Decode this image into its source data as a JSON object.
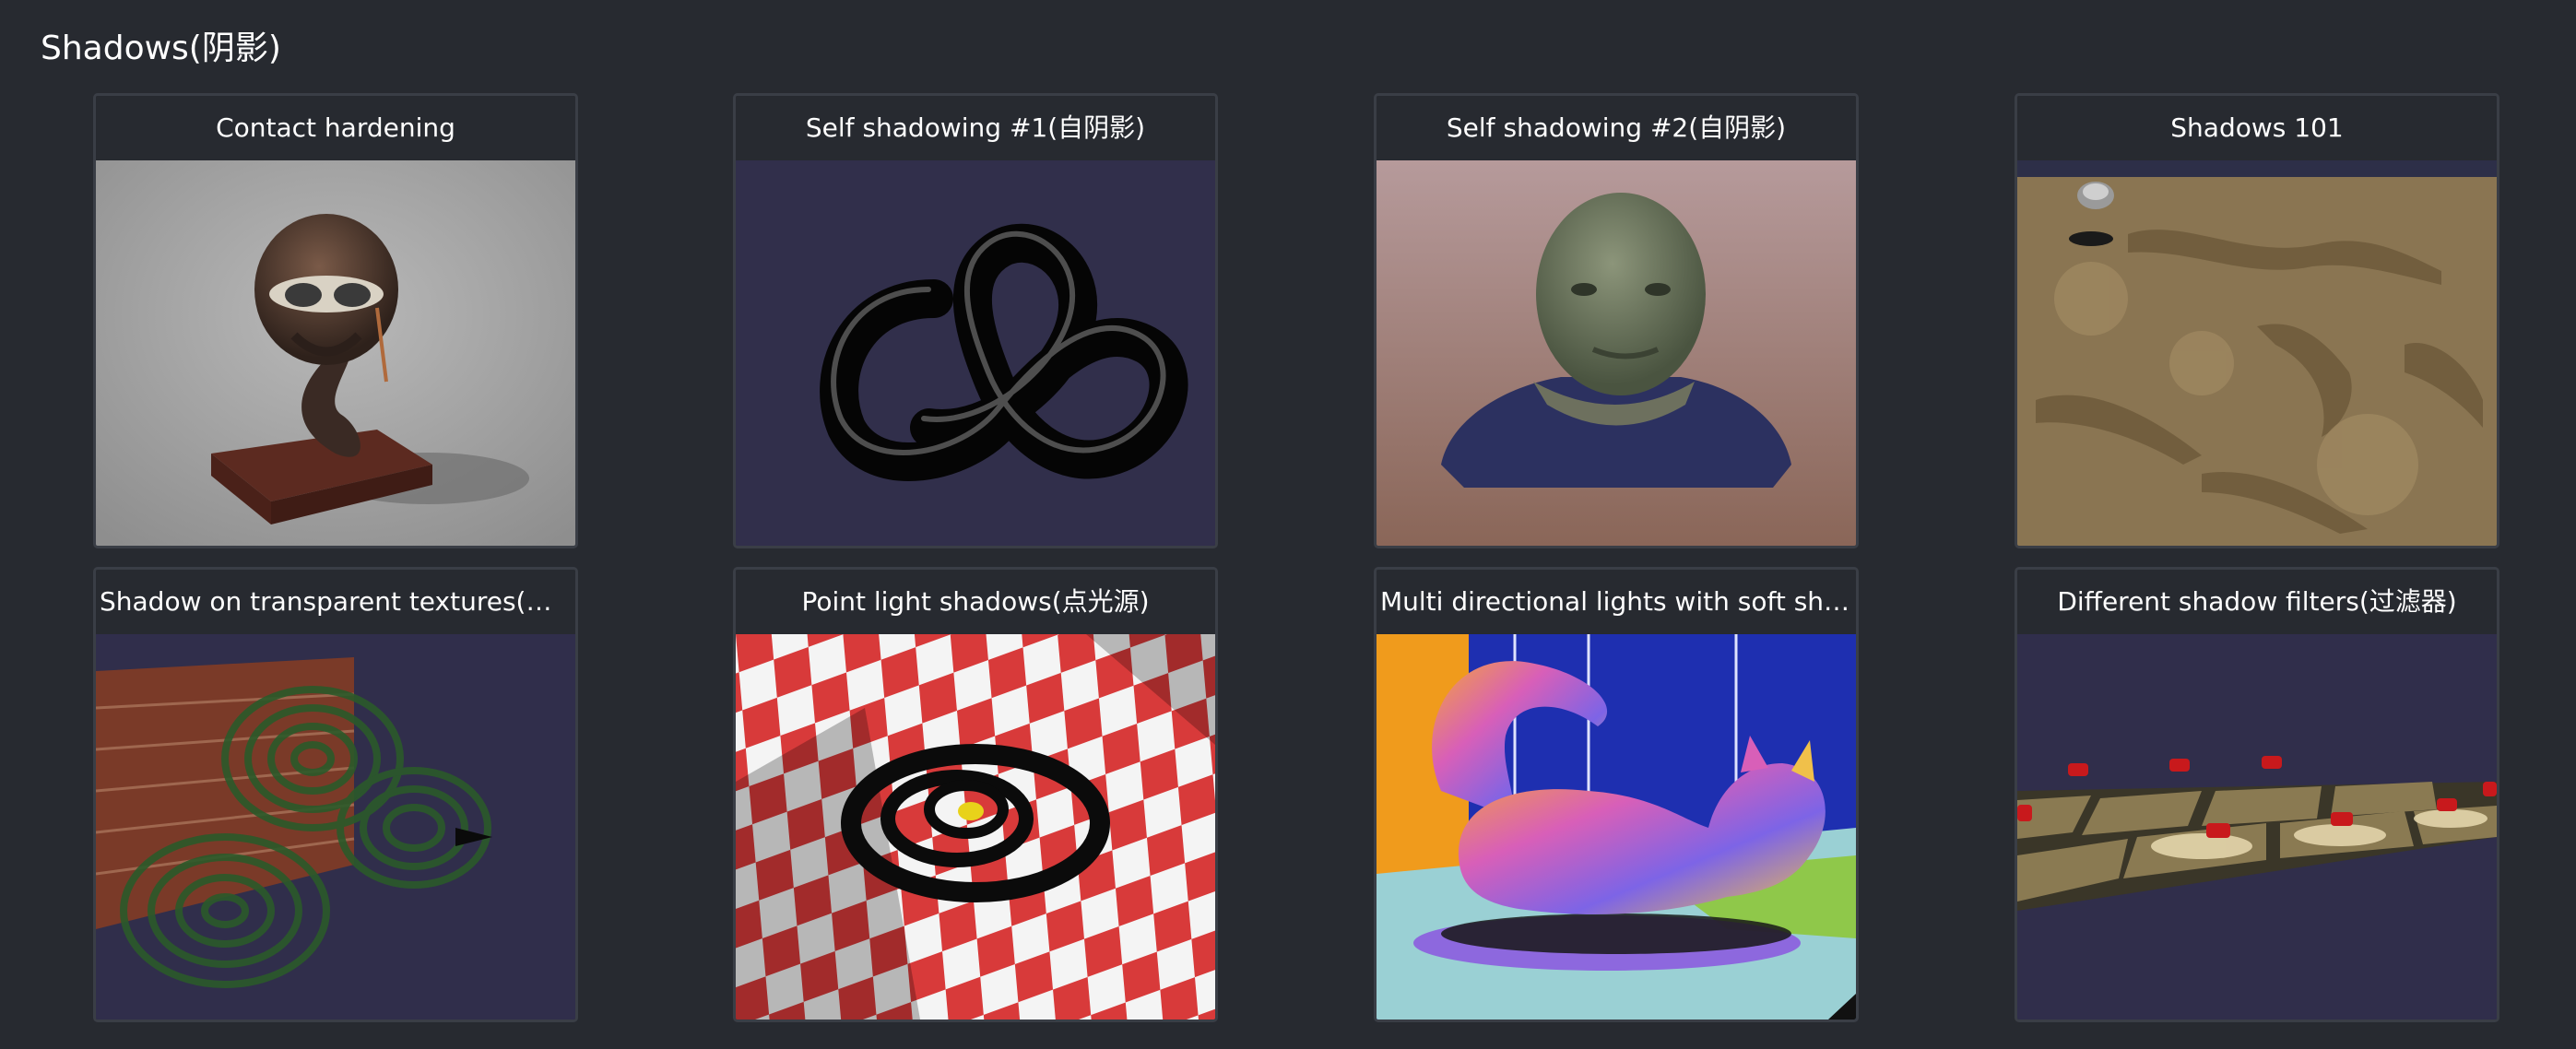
{
  "section": {
    "title": "Shadows(阴影)"
  },
  "cards": [
    {
      "title": "Contact hardening",
      "thumbnail": "helmet-bust-thumbnail"
    },
    {
      "title": "Self shadowing #1(自阴影)",
      "thumbnail": "torus-knot-thumbnail"
    },
    {
      "title": "Self shadowing #2(自阴影)",
      "thumbnail": "alien-bust-thumbnail"
    },
    {
      "title": "Shadows 101",
      "thumbnail": "terrain-thumbnail"
    },
    {
      "title": "Shadow on transparent textures(透明…",
      "thumbnail": "spirals-brick-wall-thumbnail"
    },
    {
      "title": "Point light shadows(点光源)",
      "thumbnail": "checkerboard-rings-thumbnail"
    },
    {
      "title": "Multi directional lights with soft shado…",
      "thumbnail": "cheshire-cat-thumbnail"
    },
    {
      "title": "Different shadow filters(过滤器)",
      "thumbnail": "shadow-filters-thumbnail"
    }
  ],
  "colors": {
    "background": "#272a30",
    "card_border": "#3a3e46",
    "text": "#ffffff"
  }
}
